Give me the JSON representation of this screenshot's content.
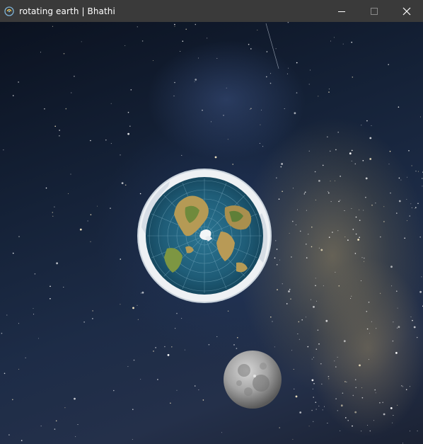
{
  "window": {
    "title": "rotating earth | Bhathi",
    "controls": {
      "minimize": "minimize-icon",
      "maximize": "maximize-icon",
      "close": "close-icon"
    }
  },
  "scene": {
    "background": "starfield with milky way",
    "objects": [
      "flat-earth-map",
      "moon"
    ],
    "colors": {
      "titlebar": "#3a3a3a",
      "ocean": "#1f5d78",
      "ice_rim": "#e3e8ee",
      "moon": "#9a9a9a"
    }
  }
}
